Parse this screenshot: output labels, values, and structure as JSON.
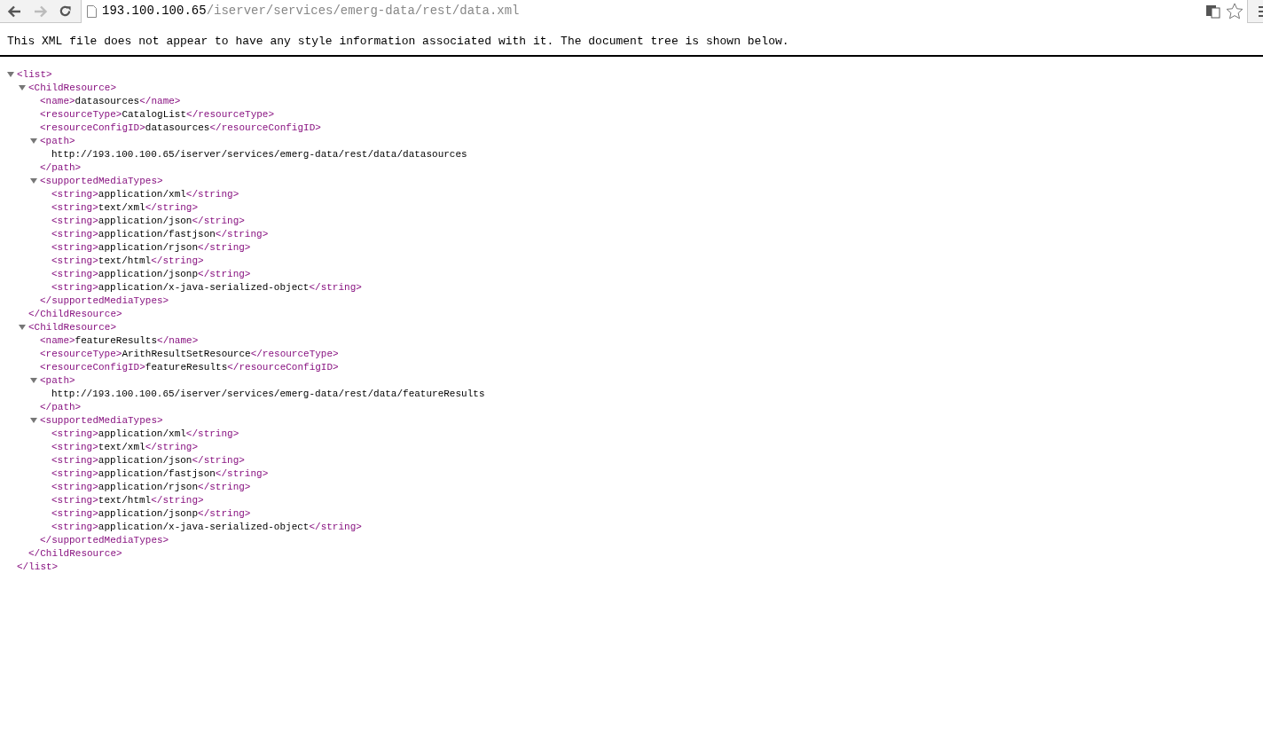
{
  "address_bar": {
    "host": "193.100.100.65",
    "path": "/iserver/services/emerg-data/rest/data.xml"
  },
  "notice": "This XML file does not appear to have any style information associated with it. The document tree is shown below.",
  "tree": [
    {
      "open": "<list>",
      "expanded": true,
      "close": "</list>",
      "children": [
        {
          "open": "<ChildResource>",
          "expanded": true,
          "close": "</ChildResource>",
          "children": [
            {
              "open": "<name>",
              "text": "datasources",
              "close": "</name>"
            },
            {
              "open": "<resourceType>",
              "text": "CatalogList",
              "close": "</resourceType>"
            },
            {
              "open": "<resourceConfigID>",
              "text": "datasources",
              "close": "</resourceConfigID>"
            },
            {
              "open": "<path>",
              "expanded": true,
              "close": "</path>",
              "children": [
                {
                  "text": "http://193.100.100.65/iserver/services/emerg-data/rest/data/datasources"
                }
              ]
            },
            {
              "open": "<supportedMediaTypes>",
              "expanded": true,
              "close": "</supportedMediaTypes>",
              "children": [
                {
                  "open": "<string>",
                  "text": "application/xml",
                  "close": "</string>"
                },
                {
                  "open": "<string>",
                  "text": "text/xml",
                  "close": "</string>"
                },
                {
                  "open": "<string>",
                  "text": "application/json",
                  "close": "</string>"
                },
                {
                  "open": "<string>",
                  "text": "application/fastjson",
                  "close": "</string>"
                },
                {
                  "open": "<string>",
                  "text": "application/rjson",
                  "close": "</string>"
                },
                {
                  "open": "<string>",
                  "text": "text/html",
                  "close": "</string>"
                },
                {
                  "open": "<string>",
                  "text": "application/jsonp",
                  "close": "</string>"
                },
                {
                  "open": "<string>",
                  "text": "application/x-java-serialized-object",
                  "close": "</string>"
                }
              ]
            }
          ]
        },
        {
          "open": "<ChildResource>",
          "expanded": true,
          "close": "</ChildResource>",
          "children": [
            {
              "open": "<name>",
              "text": "featureResults",
              "close": "</name>"
            },
            {
              "open": "<resourceType>",
              "text": "ArithResultSetResource",
              "close": "</resourceType>"
            },
            {
              "open": "<resourceConfigID>",
              "text": "featureResults",
              "close": "</resourceConfigID>"
            },
            {
              "open": "<path>",
              "expanded": true,
              "close": "</path>",
              "children": [
                {
                  "text": "http://193.100.100.65/iserver/services/emerg-data/rest/data/featureResults"
                }
              ]
            },
            {
              "open": "<supportedMediaTypes>",
              "expanded": true,
              "close": "</supportedMediaTypes>",
              "children": [
                {
                  "open": "<string>",
                  "text": "application/xml",
                  "close": "</string>"
                },
                {
                  "open": "<string>",
                  "text": "text/xml",
                  "close": "</string>"
                },
                {
                  "open": "<string>",
                  "text": "application/json",
                  "close": "</string>"
                },
                {
                  "open": "<string>",
                  "text": "application/fastjson",
                  "close": "</string>"
                },
                {
                  "open": "<string>",
                  "text": "application/rjson",
                  "close": "</string>"
                },
                {
                  "open": "<string>",
                  "text": "text/html",
                  "close": "</string>"
                },
                {
                  "open": "<string>",
                  "text": "application/jsonp",
                  "close": "</string>"
                },
                {
                  "open": "<string>",
                  "text": "application/x-java-serialized-object",
                  "close": "</string>"
                }
              ]
            }
          ]
        }
      ]
    }
  ]
}
